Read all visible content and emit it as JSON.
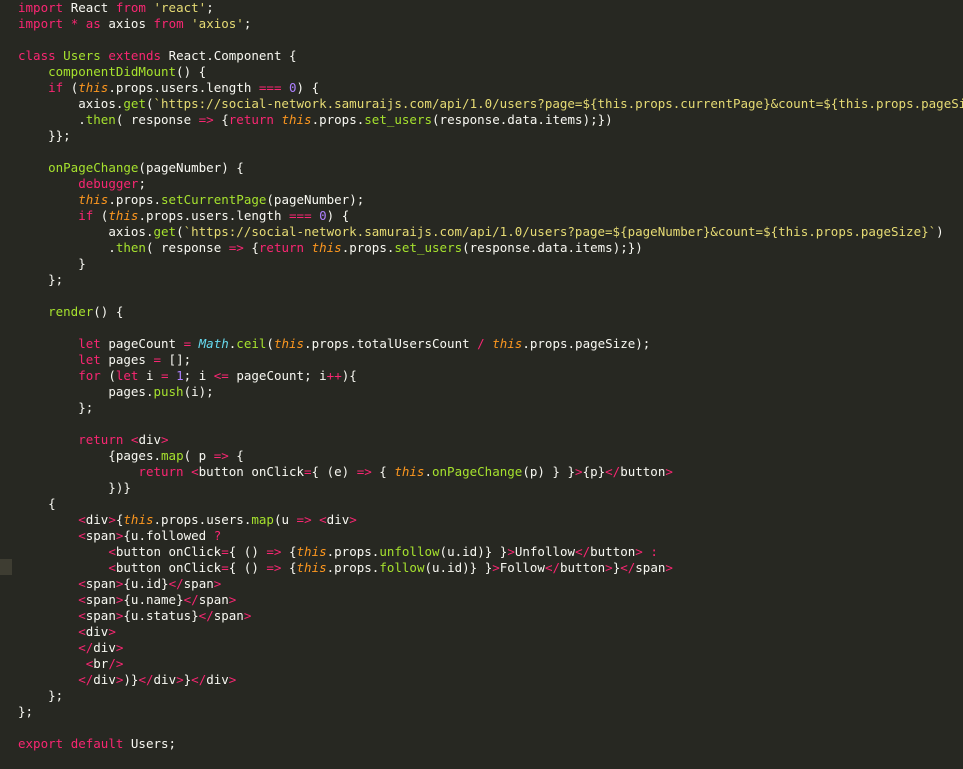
{
  "editor": {
    "theme_colors": {
      "background": "#272822",
      "keyword": "#f92672",
      "string": "#e6db74",
      "definition": "#66d9ef",
      "function": "#a6e22e",
      "this": "#fd971f",
      "number": "#ae81ff",
      "text": "#f8f8f2"
    },
    "lines": [
      "import React from 'react';",
      "import * as axios from 'axios';",
      "",
      "class Users extends React.Component {",
      "    componentDidMount() {",
      "    if (this.props.users.length === 0) {",
      "        axios.get(`https://social-network.samuraijs.com/api/1.0/users?page=${this.props.currentPage}&count=${this.props.pageSize}`)",
      "        .then( response => {return this.props.set_users(response.data.items);})",
      "    }};",
      "",
      "    onPageChange(pageNumber) {",
      "        debugger;",
      "        this.props.setCurrentPage(pageNumber);",
      "        if (this.props.users.length === 0) {",
      "            axios.get(`https://social-network.samuraijs.com/api/1.0/users?page=${pageNumber}&count=${this.props.pageSize}`)",
      "            .then( response => {return this.props.set_users(response.data.items);})",
      "        }",
      "    };",
      "",
      "    render() {",
      "",
      "        let pageCount = Math.ceil(this.props.totalUsersCount / this.props.pageSize);",
      "        let pages = [];",
      "        for (let i = 1; i <= pageCount; i++){",
      "            pages.push(i);",
      "        };",
      "",
      "        return <div>",
      "            {pages.map( p => {",
      "                return <button onClick={ (e) => { this.onPageChange(p) } }>{p}</button>",
      "            })}",
      "    {",
      "        <div>{this.props.users.map(u => <div>",
      "        <span>{u.followed ?",
      "            <button onClick={ () => {this.props.unfollow(u.id)} }>Unfollow</button> :",
      "            <button onClick={ () => {this.props.follow(u.id)} }>Follow</button>}</span>",
      "        <span>{u.id}</span>",
      "        <span>{u.name}</span>",
      "        <span>{u.status}</span>",
      "        <div>",
      "        </div>",
      "         <br/>",
      "        </div>)}</div>}</div>",
      "    };",
      "};",
      "",
      "export default Users;"
    ]
  }
}
